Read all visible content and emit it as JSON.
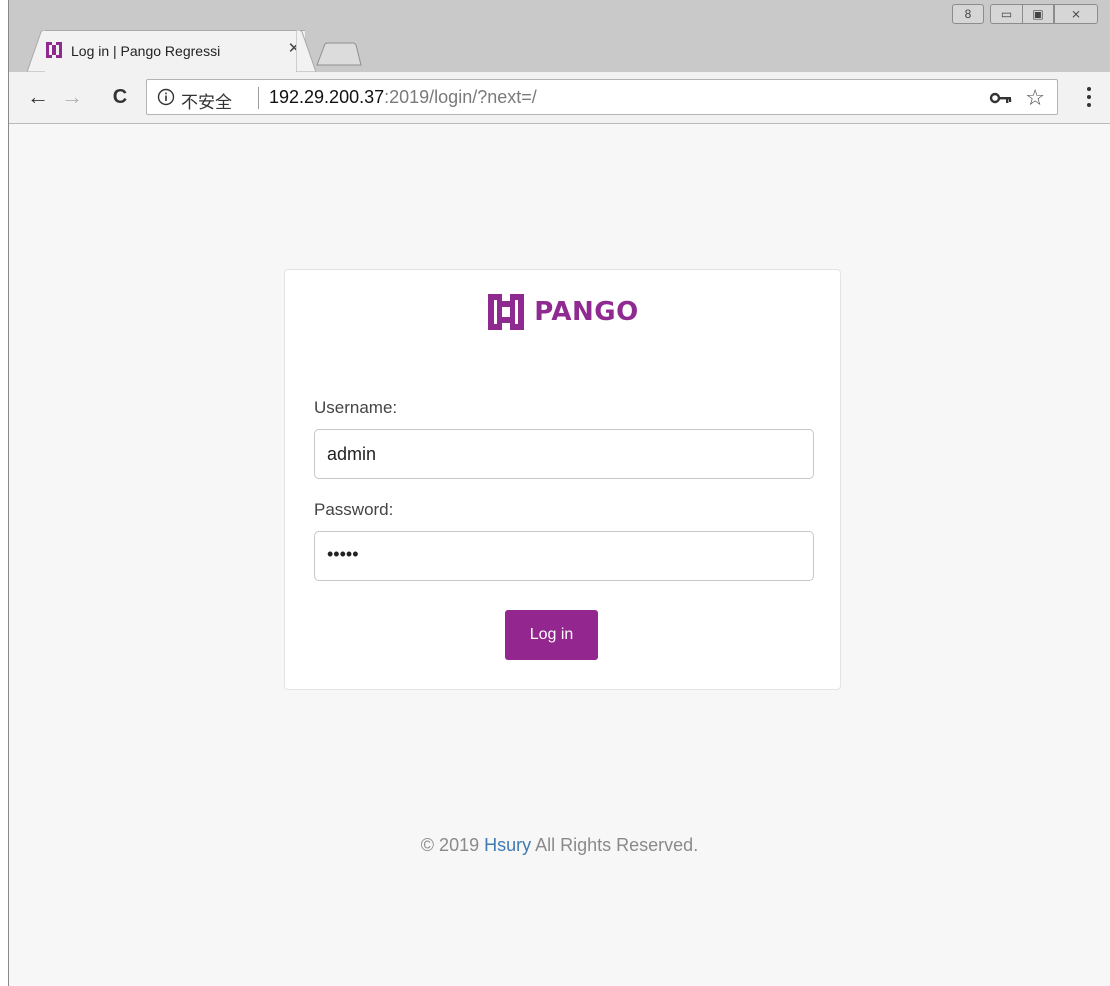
{
  "browser": {
    "tab": {
      "title": "Log in | Pango Regressi",
      "close_glyph": "✕",
      "favicon": "pango-logo-icon"
    },
    "toolbar": {
      "back_glyph": "←",
      "forward_glyph": "→",
      "reload_glyph": "C",
      "security_label": "不安全",
      "url_host": "192.29.200.37",
      "url_rest": ":2019/login/?next=/",
      "star_glyph": "☆"
    },
    "window_controls": {
      "user_glyph": "8",
      "minimize_glyph": "▭",
      "maximize_glyph": "▣",
      "close_glyph": "⨯"
    }
  },
  "login": {
    "brand": "PANGO",
    "username_label": "Username:",
    "username_value": "admin",
    "password_label": "Password:",
    "password_value": "•••••",
    "submit_label": "Log in"
  },
  "footer": {
    "prefix": "© 2019 ",
    "link": "Hsury",
    "suffix": " All Rights Reserved."
  },
  "colors": {
    "brand": "#93268f",
    "link": "#3f7bb0",
    "page_bg": "#f7f7f7"
  }
}
